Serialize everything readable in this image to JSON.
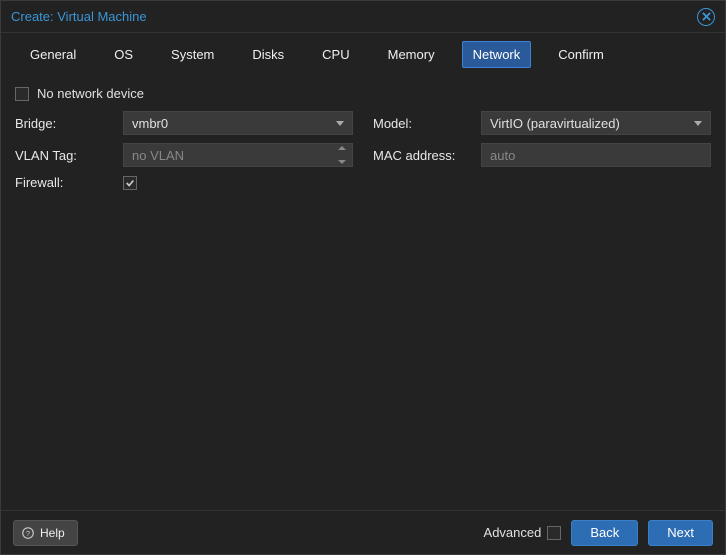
{
  "title": "Create: Virtual Machine",
  "tabs": {
    "general": "General",
    "os": "OS",
    "system": "System",
    "disks": "Disks",
    "cpu": "CPU",
    "memory": "Memory",
    "network": "Network",
    "confirm": "Confirm"
  },
  "network": {
    "no_device_label": "No network device",
    "bridge_label": "Bridge:",
    "bridge_value": "vmbr0",
    "vlan_label": "VLAN Tag:",
    "vlan_placeholder": "no VLAN",
    "firewall_label": "Firewall:",
    "firewall_checked": true,
    "model_label": "Model:",
    "model_value": "VirtIO (paravirtualized)",
    "mac_label": "MAC address:",
    "mac_placeholder": "auto"
  },
  "footer": {
    "help": "Help",
    "advanced": "Advanced",
    "back": "Back",
    "next": "Next"
  }
}
